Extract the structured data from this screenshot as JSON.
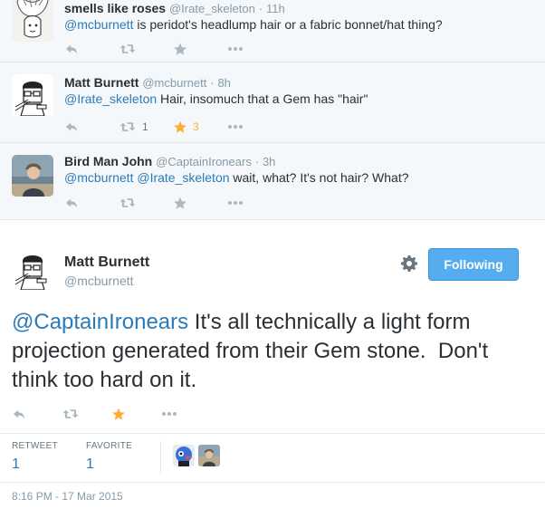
{
  "replies": [
    {
      "fullname": "smells like roses",
      "handle": "@Irate_skeleton",
      "time": "11h",
      "mentions": [
        "@mcburnett"
      ],
      "text": " is peridot's headlump hair or a fabric bonnet/hat thing?",
      "retweet_count": "",
      "favorite_count": ""
    },
    {
      "fullname": "Matt Burnett",
      "handle": "@mcburnett",
      "time": "8h",
      "mentions": [
        "@Irate_skeleton"
      ],
      "text": " Hair, insomuch that a Gem has \"hair\"",
      "retweet_count": "1",
      "favorite_count": "3"
    },
    {
      "fullname": "Bird Man John",
      "handle": "@CaptainIronears",
      "time": "3h",
      "mentions": [
        "@mcburnett",
        "@Irate_skeleton"
      ],
      "text": " wait, what? It's not hair? What?",
      "retweet_count": "",
      "favorite_count": ""
    }
  ],
  "main_tweet": {
    "fullname": "Matt Burnett",
    "handle": "@mcburnett",
    "follow_label": "Following",
    "mention": "@CaptainIronears",
    "text": " It's all technically a light form projection generated from their Gem stone.  Don't think too hard on it.",
    "stats": {
      "retweet_label": "RETWEET",
      "retweet_count": "1",
      "favorite_label": "FAVORITE",
      "favorite_count": "1"
    },
    "timestamp": "8:16 PM - 17 Mar 2015"
  },
  "colors": {
    "link": "#2b7bb9",
    "follow_button": "#55acee",
    "favorite_star": "#ffac33",
    "icon_gray": "#aab8c2",
    "thread_bg": "#f5f8fa"
  },
  "icons": [
    "reply-icon",
    "retweet-icon",
    "favorite-icon",
    "more-icon",
    "gear-icon"
  ]
}
